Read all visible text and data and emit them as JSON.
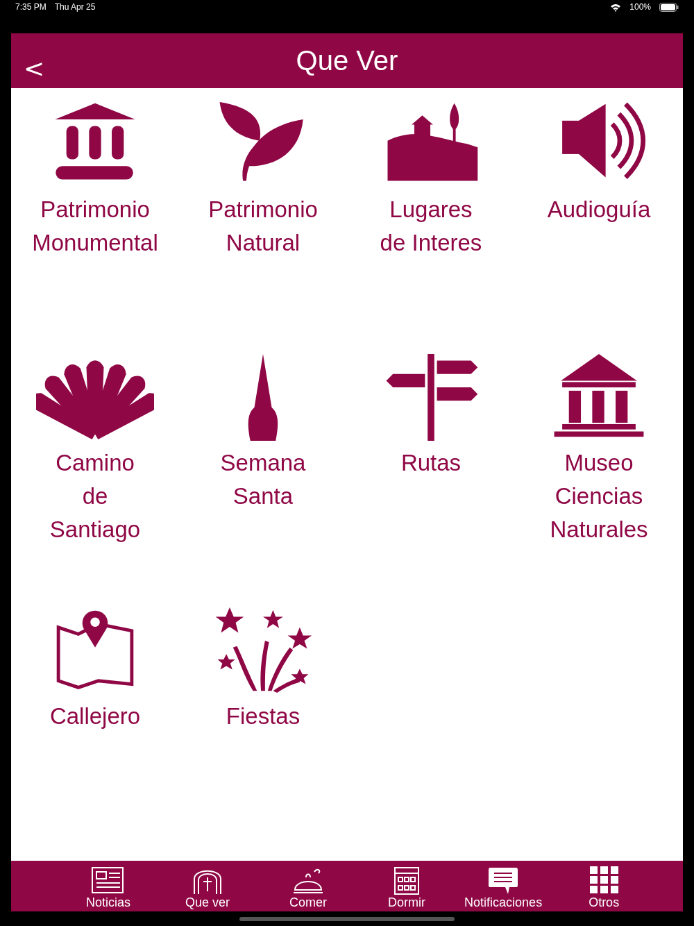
{
  "status_bar": {
    "time": "7:35 PM",
    "date": "Thu Apr 25",
    "battery": "100%"
  },
  "header": {
    "back": "<",
    "title": "Que Ver"
  },
  "tiles": [
    {
      "kind": "monument",
      "label": "Patrimonio\nMonumental"
    },
    {
      "kind": "leaf",
      "label": "Patrimonio\nNatural"
    },
    {
      "kind": "landscape",
      "label": "Lugares\nde Interes"
    },
    {
      "kind": "speaker",
      "label": "Audioguía"
    },
    {
      "kind": "shell",
      "label": "Camino\nde\nSantiago"
    },
    {
      "kind": "hood",
      "label": "Semana\nSanta"
    },
    {
      "kind": "signpost",
      "label": "Rutas"
    },
    {
      "kind": "museum",
      "label": "Museo\nCiencias\nNaturales"
    },
    {
      "kind": "map",
      "label": "Callejero"
    },
    {
      "kind": "fireworks",
      "label": "Fiestas"
    }
  ],
  "tab_bar": [
    {
      "kind": "news",
      "label": "Noticias"
    },
    {
      "kind": "arch",
      "label": "Que ver"
    },
    {
      "kind": "cloche",
      "label": "Comer"
    },
    {
      "kind": "hotel",
      "label": "Dormir"
    },
    {
      "kind": "chat",
      "label": "Notificaciones"
    },
    {
      "kind": "grid",
      "label": "Otros"
    }
  ]
}
